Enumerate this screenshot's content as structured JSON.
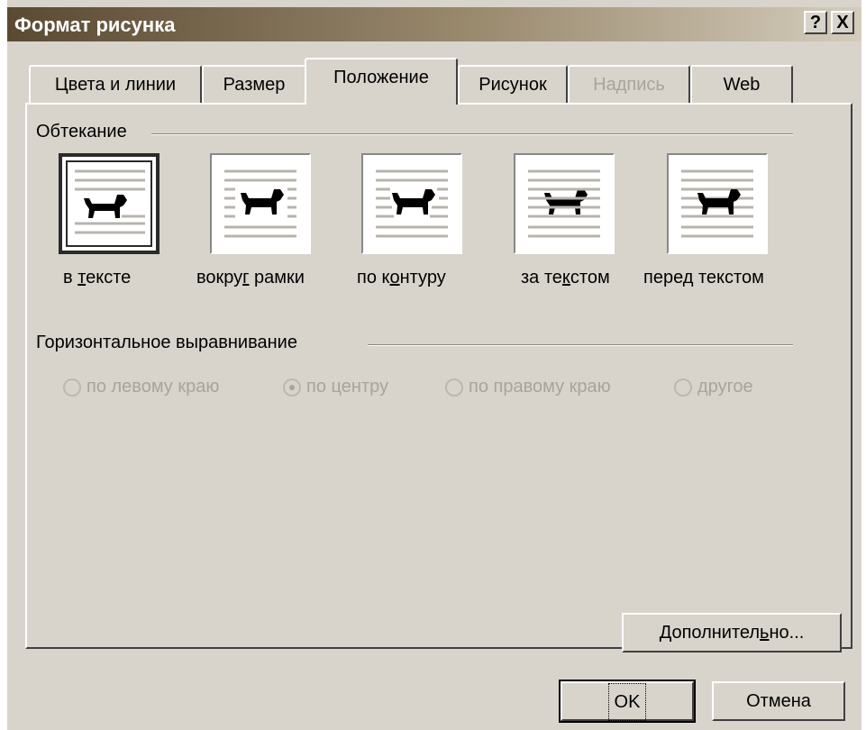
{
  "window": {
    "title": "Формат рисунка",
    "help_label": "?",
    "close_label": "X"
  },
  "tabs": [
    {
      "label": "Цвета и линии",
      "state": "normal"
    },
    {
      "label": "Размер",
      "state": "normal"
    },
    {
      "label": "Положение",
      "state": "active"
    },
    {
      "label": "Рисунок",
      "state": "normal"
    },
    {
      "label": "Надпись",
      "state": "disabled"
    },
    {
      "label": "Web",
      "state": "normal"
    }
  ],
  "wrapping": {
    "group_label": "Обтекание",
    "options": [
      {
        "pre": "в ",
        "u": "т",
        "post": "ексте",
        "icon": "dog-in-line-icon",
        "selected": true
      },
      {
        "pre": "вокру",
        "u": "г",
        "post": " рамки",
        "icon": "dog-square-wrap-icon",
        "selected": false
      },
      {
        "pre": "по к",
        "u": "о",
        "post": "нтуру",
        "icon": "dog-tight-wrap-icon",
        "selected": false
      },
      {
        "pre": "за те",
        "u": "к",
        "post": "стом",
        "icon": "dog-behind-text-icon",
        "selected": false
      },
      {
        "pre": "пере",
        "u": "д",
        "post": " текстом",
        "icon": "dog-in-front-of-text-icon",
        "selected": false
      }
    ]
  },
  "alignment": {
    "group_label": "Горизонтальное выравнивание",
    "options": [
      {
        "label": "по левому краю",
        "checked": false
      },
      {
        "label": "по центру",
        "checked": true
      },
      {
        "label": "по правому краю",
        "checked": false
      },
      {
        "label": "другое",
        "checked": false
      }
    ],
    "enabled": false
  },
  "buttons": {
    "advanced": {
      "pre": "Дополнител",
      "u": "ь",
      "post": "но..."
    },
    "ok": "OK",
    "cancel": "Отмена"
  },
  "colors": {
    "face": "#d8d4cc",
    "title_dark": "#5a4a32",
    "disabled_text": "#a8a49c"
  }
}
